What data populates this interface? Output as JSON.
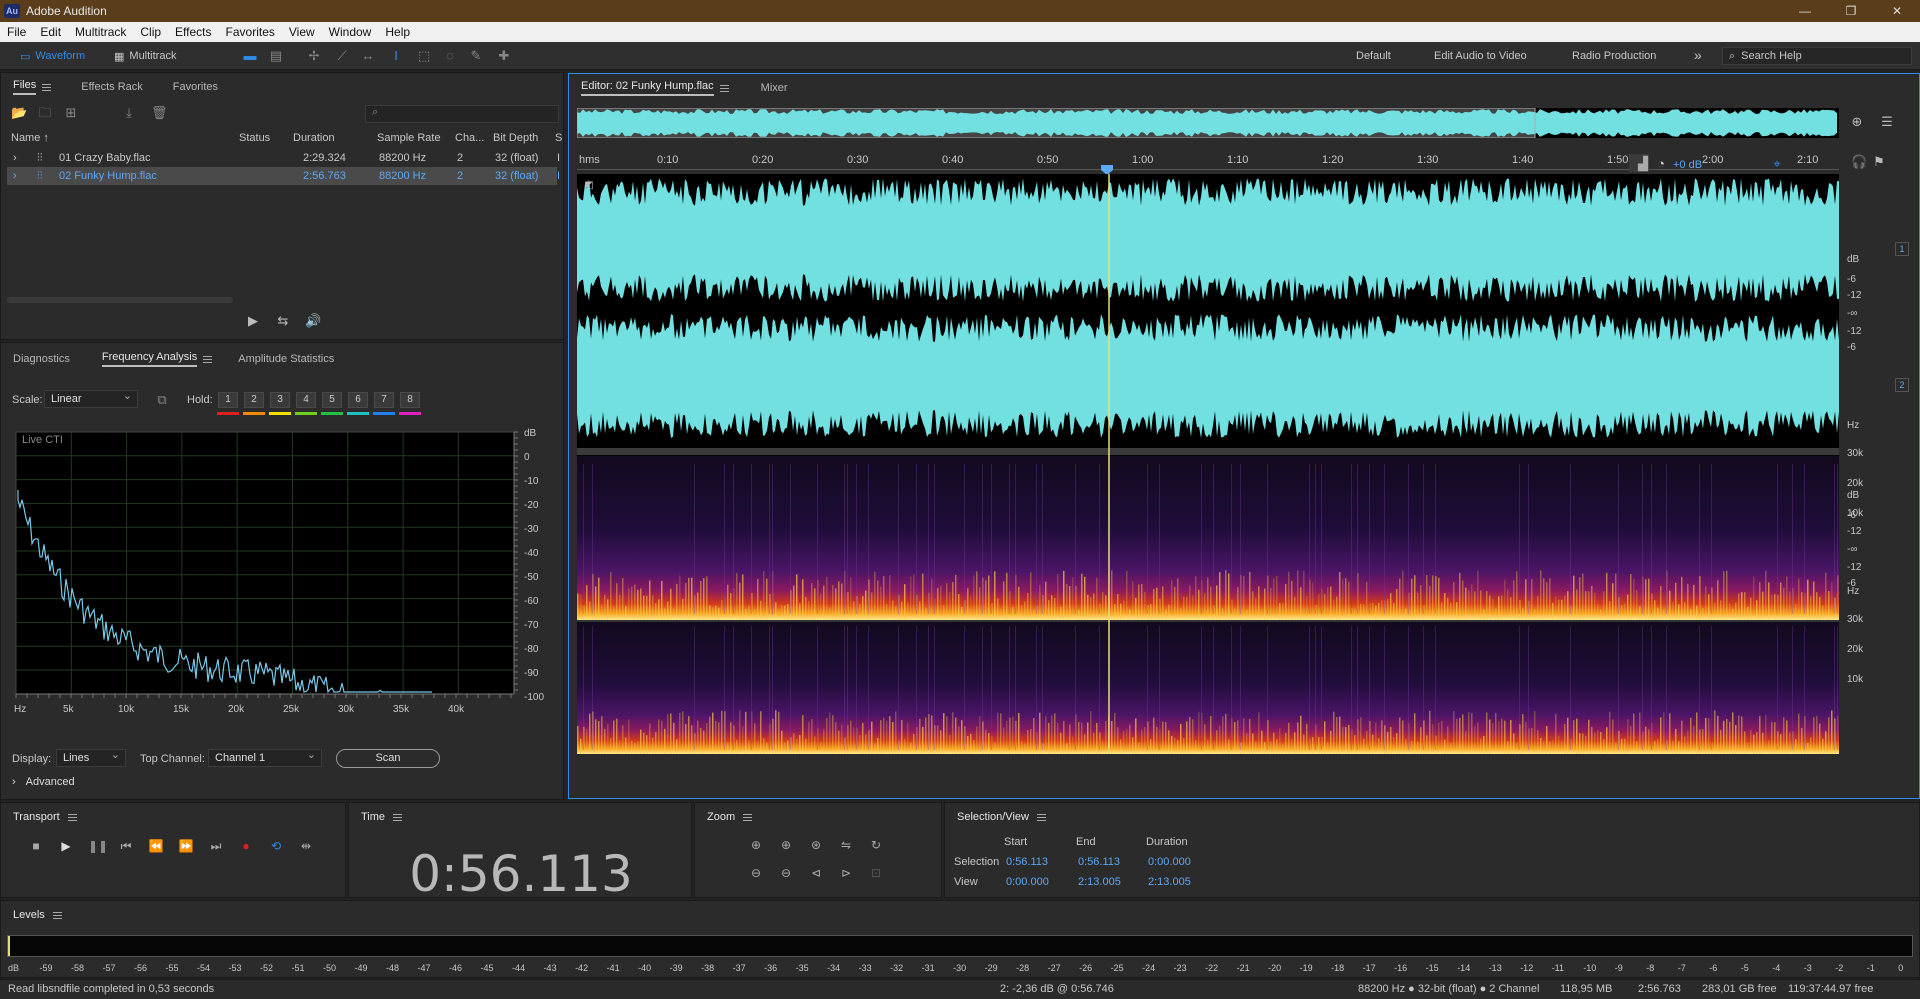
{
  "app": {
    "title": "Adobe Audition",
    "logo": "Au"
  },
  "menu": [
    "File",
    "Edit",
    "Multitrack",
    "Clip",
    "Effects",
    "Favorites",
    "View",
    "Window",
    "Help"
  ],
  "toolbar": {
    "waveform": "Waveform",
    "multitrack": "Multitrack",
    "workspaces": [
      "Default",
      "Edit Audio to Video",
      "Radio Production"
    ],
    "more": "»",
    "search_help": "Search Help"
  },
  "files_panel": {
    "tabs": [
      "Files",
      "Effects Rack",
      "Favorites"
    ],
    "columns": [
      "Name",
      "Status",
      "Duration",
      "Sample Rate",
      "Cha...",
      "Bit Depth",
      "S"
    ],
    "rows": [
      {
        "name": "01 Crazy Baby.flac",
        "status": "",
        "duration": "2:29.324",
        "sample_rate": "88200 Hz",
        "channels": "2",
        "bit_depth": "32 (float)",
        "s": "I"
      },
      {
        "name": "02 Funky Hump.flac",
        "status": "",
        "duration": "2:56.763",
        "sample_rate": "88200 Hz",
        "channels": "2",
        "bit_depth": "32 (float)",
        "s": "I"
      }
    ]
  },
  "analysis_panel": {
    "tabs": [
      "Diagnostics",
      "Frequency Analysis",
      "Amplitude Statistics"
    ],
    "scale_label": "Scale:",
    "scale_value": "Linear",
    "hold_label": "Hold:",
    "holds": [
      "1",
      "2",
      "3",
      "4",
      "5",
      "6",
      "7",
      "8"
    ],
    "hold_colors": [
      "#e02020",
      "#f08a00",
      "#f0e000",
      "#70d020",
      "#20c040",
      "#20c0c0",
      "#2080f0",
      "#e020c0"
    ],
    "graph_label": "Live CTI",
    "db_ticks": [
      "dB",
      "0",
      "-10",
      "-20",
      "-30",
      "-40",
      "-50",
      "-60",
      "-70",
      "-80",
      "-90",
      "-100"
    ],
    "hz_ticks": [
      "Hz",
      "5k",
      "10k",
      "15k",
      "20k",
      "25k",
      "30k",
      "35k",
      "40k"
    ],
    "display_label": "Display:",
    "display_value": "Lines",
    "top_channel_label": "Top Channel:",
    "top_channel_value": "Channel 1",
    "scan": "Scan",
    "advanced": "Advanced"
  },
  "editor": {
    "tab": "Editor: 02 Funky Hump.flac",
    "mixer": "Mixer",
    "ruler": [
      "hms",
      "0:10",
      "0:20",
      "0:30",
      "0:40",
      "0:50",
      "1:00",
      "1:10",
      "1:20",
      "1:30",
      "1:40",
      "1:50",
      "2:00",
      "2:10"
    ],
    "gain": "+0 dB",
    "db_scale": [
      "dB",
      "-6",
      "-12",
      "-∞",
      "-12",
      "-6"
    ],
    "channel_1": "1",
    "channel_2": "2",
    "hz_scale": [
      "Hz",
      "30k",
      "20k",
      "10k"
    ],
    "waveform_color": "#72e0e0",
    "playhead_color": "#e8e070"
  },
  "transport": {
    "title": "Transport"
  },
  "time": {
    "title": "Time",
    "value": "0:56.113"
  },
  "zoom": {
    "title": "Zoom"
  },
  "selection_view": {
    "title": "Selection/View",
    "headers": [
      "Start",
      "End",
      "Duration"
    ],
    "selection_label": "Selection",
    "selection": [
      "0:56.113",
      "0:56.113",
      "0:00.000"
    ],
    "view_label": "View",
    "view": [
      "0:00.000",
      "2:13.005",
      "2:13.005"
    ]
  },
  "levels": {
    "title": "Levels",
    "ticks": [
      "dB",
      "-59",
      "-58",
      "-57",
      "-56",
      "-55",
      "-54",
      "-53",
      "-52",
      "-51",
      "-50",
      "-49",
      "-48",
      "-47",
      "-46",
      "-45",
      "-44",
      "-43",
      "-42",
      "-41",
      "-40",
      "-39",
      "-38",
      "-37",
      "-36",
      "-35",
      "-34",
      "-33",
      "-32",
      "-31",
      "-30",
      "-29",
      "-28",
      "-27",
      "-26",
      "-25",
      "-24",
      "-23",
      "-22",
      "-21",
      "-20",
      "-19",
      "-18",
      "-17",
      "-16",
      "-15",
      "-14",
      "-13",
      "-12",
      "-11",
      "-10",
      "-9",
      "-8",
      "-7",
      "-6",
      "-5",
      "-4",
      "-3",
      "-2",
      "-1",
      "0"
    ]
  },
  "status": {
    "message": "Read libsndfile completed in 0,53 seconds",
    "cursor": "2: -2,36 dB @ 0:56.746",
    "format": "88200 Hz ● 32-bit (float) ● 2 Channel",
    "size": "118,95 MB",
    "duration": "2:56.763",
    "free": "283,01 GB free",
    "free_time": "119:37:44.97 free"
  }
}
